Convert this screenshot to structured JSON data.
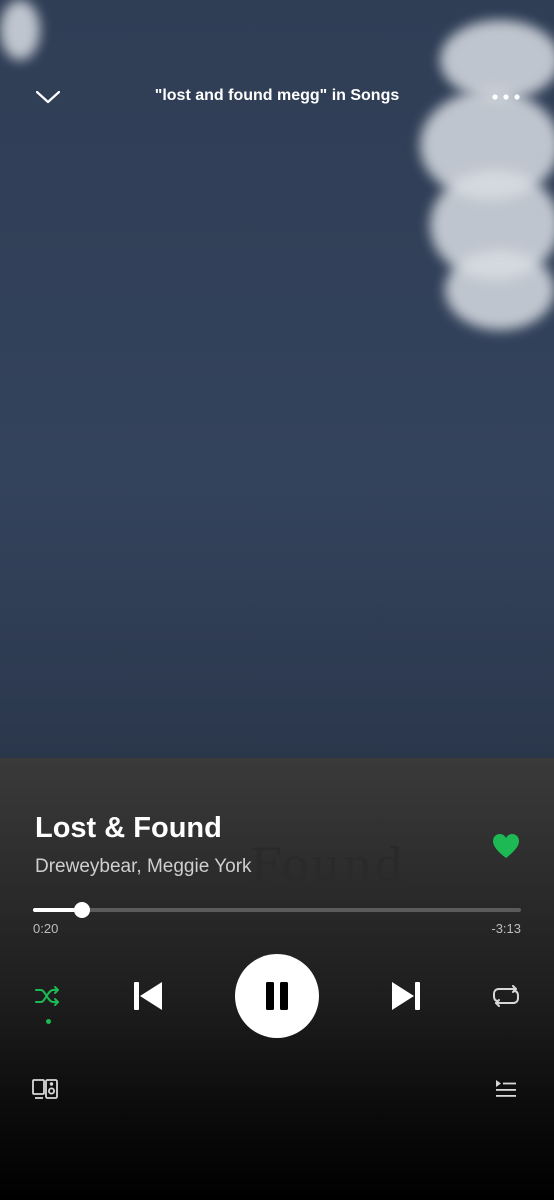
{
  "header": {
    "context_title": "\"lost and found megg\" in Songs"
  },
  "track": {
    "title": "Lost & Found",
    "artists": "Dreweybear, Meggie York",
    "liked": true,
    "canvas_ghost_text": "Found"
  },
  "playback": {
    "elapsed": "0:20",
    "remaining": "-3:13",
    "progress_fraction": 0.1,
    "is_playing": true,
    "shuffle_on": true
  },
  "colors": {
    "accent": "#1db954",
    "text_secondary": "#cfcfcf"
  },
  "icons": {
    "collapse": "chevron-down-icon",
    "more": "more-options-icon",
    "like": "heart-icon",
    "shuffle": "shuffle-icon",
    "previous": "skip-previous-icon",
    "pause": "pause-icon",
    "next": "skip-next-icon",
    "repeat": "repeat-icon",
    "devices": "devices-icon",
    "queue": "queue-icon"
  }
}
